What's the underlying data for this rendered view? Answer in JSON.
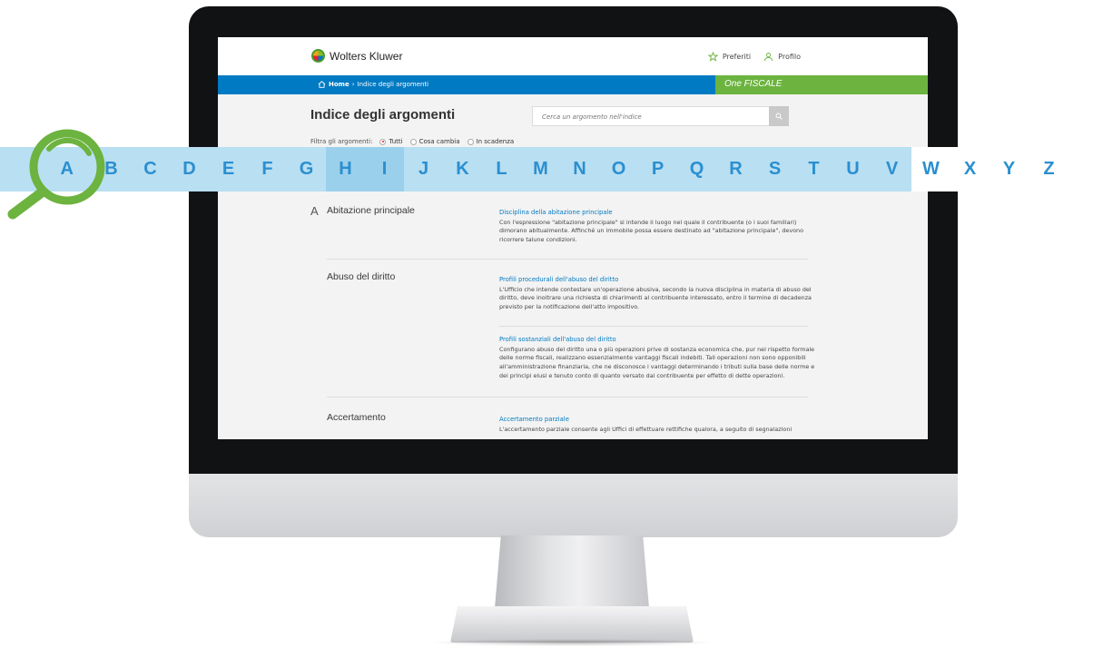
{
  "brand": {
    "name": "Wolters Kluwer",
    "product": "One FISCALE"
  },
  "header": {
    "favorites_label": "Preferiti",
    "profile_label": "Profilo"
  },
  "breadcrumb": {
    "home": "Home",
    "separator": "›",
    "current": "Indice degli argomenti"
  },
  "page": {
    "title": "Indice degli argomenti"
  },
  "search": {
    "placeholder": "Cerca un argomento nell'indice"
  },
  "filters": {
    "label": "Filtra gli argomenti:",
    "options": [
      {
        "label": "Tutti",
        "selected": true
      },
      {
        "label": "Cosa cambia",
        "selected": false
      },
      {
        "label": "In scadenza",
        "selected": false
      }
    ]
  },
  "index": {
    "letter": "A",
    "topics": [
      {
        "name": "Abitazione principale",
        "articles": [
          {
            "title": "Disciplina della abitazione principale",
            "text": "Con l'espressione \"abitazione principale\" si intende il luogo nel quale il contribuente (o i suoi familiari) dimorano abitualmente. Affinché un immobile possa essere destinato ad \"abitazione principale\", devono ricorrere talune condizioni."
          }
        ]
      },
      {
        "name": "Abuso del diritto",
        "articles": [
          {
            "title": "Profili procedurali dell'abuso del diritto",
            "text": "L'Ufficio che intende contestare un'operazione abusiva, secondo la nuova disciplina in materia di abuso del diritto, deve inoltrare una richiesta di chiarimenti al contribuente interessato, entro il termine di decadenza previsto per la notificazione dell'atto impositivo."
          },
          {
            "title": "Profili sostanziali dell'abuso del diritto",
            "text": "Configurano abuso del diritto una o più operazioni prive di sostanza economica che, pur nel rispetto formale delle norme fiscali, realizzano essenzialmente vantaggi fiscali indebiti. Tali operazioni non sono opponibili all'amministrazione finanziaria, che ne disconosce i vantaggi determinando i tributi sulla base delle norme e dei principi elusi e tenuto conto di quanto versato dal contribuente per effetto di dette operazioni."
          }
        ]
      },
      {
        "name": "Accertamento",
        "articles": [
          {
            "title": "Accertamento parziale",
            "text": "L'accertamento parziale consente agli Uffici di effettuare rettifiche qualora, a seguito di segnalazioni"
          }
        ]
      }
    ]
  },
  "alphabet": {
    "letters": [
      "A",
      "B",
      "C",
      "D",
      "E",
      "F",
      "G",
      "H",
      "I",
      "J",
      "K",
      "L",
      "M",
      "N",
      "O",
      "P",
      "Q",
      "R",
      "S",
      "T",
      "U",
      "V",
      "W",
      "X",
      "Y",
      "Z"
    ],
    "active": "A"
  },
  "colors": {
    "blue": "#007ac3",
    "green": "#6cb33f",
    "band_light": "#b9dff2",
    "band_dark": "#9bd0ec",
    "letter": "#2a8fd0",
    "magnifier": "#6cb33f"
  },
  "icons": {
    "favorites": "star-icon",
    "profile": "user-icon",
    "home": "home-icon",
    "search": "search-icon",
    "magnifier": "magnifier-icon"
  }
}
